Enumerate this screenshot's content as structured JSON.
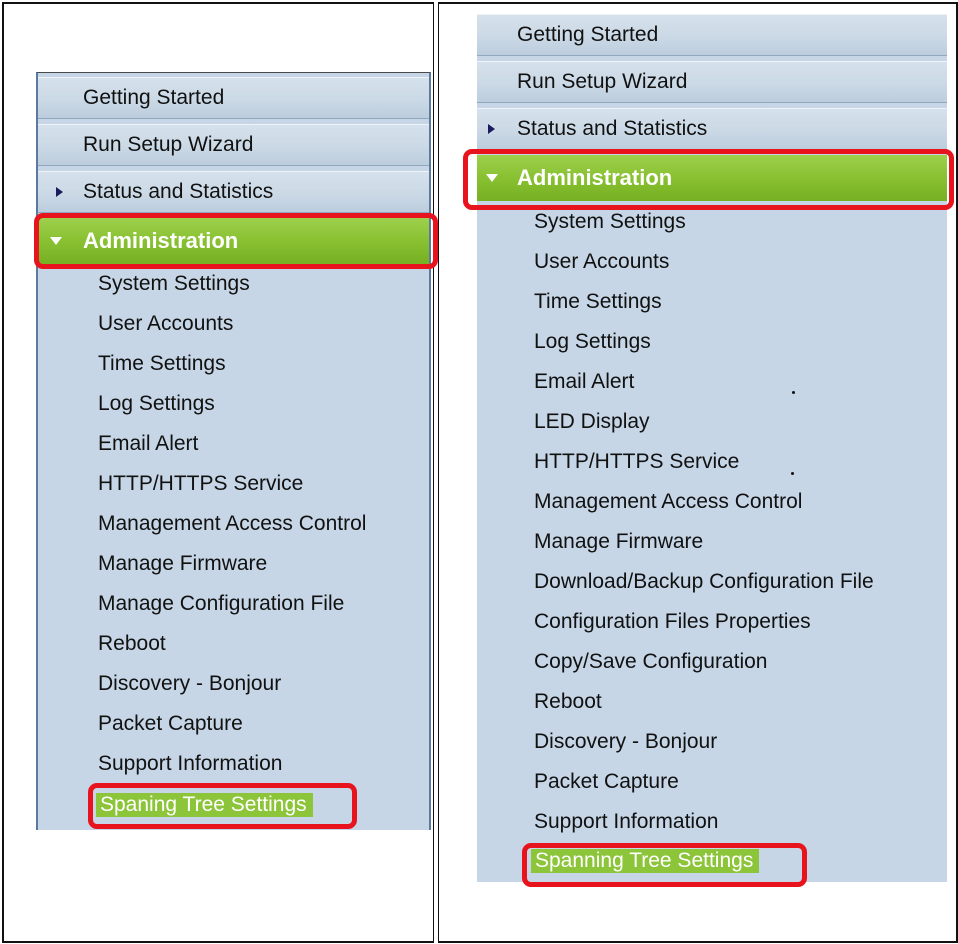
{
  "left_nav": {
    "headers": [
      {
        "label": "Getting Started",
        "arrow": false
      },
      {
        "label": "Run Setup Wizard",
        "arrow": false
      },
      {
        "label": "Status and Statistics",
        "arrow": true
      }
    ],
    "active": {
      "label": "Administration",
      "expanded": true
    },
    "items": [
      "System Settings",
      "User Accounts",
      "Time Settings",
      "Log Settings",
      "Email Alert",
      "HTTP/HTTPS Service",
      "Management Access Control",
      "Manage Firmware",
      "Manage Configuration File",
      "Reboot",
      "Discovery - Bonjour",
      "Packet Capture",
      "Support Information"
    ],
    "selected_item": "Spaning Tree Settings"
  },
  "right_nav": {
    "headers": [
      {
        "label": "Getting Started",
        "arrow": false
      },
      {
        "label": "Run Setup Wizard",
        "arrow": false
      },
      {
        "label": "Status and Statistics",
        "arrow": true
      }
    ],
    "active": {
      "label": "Administration",
      "expanded": true
    },
    "items": [
      "System Settings",
      "User Accounts",
      "Time Settings",
      "Log Settings",
      "Email Alert",
      "LED Display",
      "HTTP/HTTPS Service",
      "Management Access Control",
      "Manage Firmware",
      "Download/Backup Configuration File",
      "Configuration Files Properties",
      "Copy/Save Configuration",
      "Reboot",
      "Discovery - Bonjour",
      "Packet Capture",
      "Support Information"
    ],
    "selected_item": "Spanning Tree Settings"
  },
  "colors": {
    "nav_background": "#c6d6e6",
    "active_green": "#86bf2f",
    "highlight_red": "#e8141d",
    "arrow_navy": "#1a1a5e"
  }
}
